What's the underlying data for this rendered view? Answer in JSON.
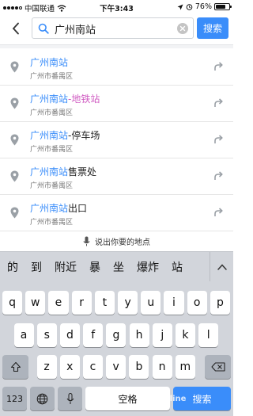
{
  "status_bar": {
    "carrier": "中国联通",
    "network": "WiFi",
    "time": "下午3:43",
    "battery": "76%",
    "battery_level": 0.76
  },
  "search": {
    "query": "广州南站",
    "submit_label": "搜索"
  },
  "suggestions": [
    {
      "highlight": "广州南站",
      "suffix": "",
      "suffix_style": "plain",
      "address": "广州市番禺区"
    },
    {
      "highlight": "广州南站",
      "suffix": "-地铁站",
      "suffix_style": "metro",
      "address": "广州市番禺区"
    },
    {
      "highlight": "广州南站",
      "suffix": "-停车场",
      "suffix_style": "plain",
      "address": "广州市番禺区"
    },
    {
      "highlight": "广州南站",
      "suffix": "售票处",
      "suffix_style": "plain",
      "address": "广州市番禺区"
    },
    {
      "highlight": "广州南站",
      "suffix": "出口",
      "suffix_style": "plain",
      "address": "广州市番禺区"
    }
  ],
  "voice_prompt": "说出你要的地点",
  "ime_candidates": [
    "的",
    "到",
    "附近",
    "暴",
    "坐",
    "爆炸",
    "站"
  ],
  "keyboard": {
    "row1": [
      "q",
      "w",
      "e",
      "r",
      "t",
      "y",
      "u",
      "i",
      "o",
      "p"
    ],
    "row2": [
      "a",
      "s",
      "d",
      "f",
      "g",
      "h",
      "j",
      "k",
      "l"
    ],
    "row3": [
      "z",
      "x",
      "c",
      "v",
      "b",
      "n",
      "m"
    ],
    "numbers_label": "123",
    "space_label": "空格",
    "search_label": "搜索"
  },
  "watermark": "PConline"
}
